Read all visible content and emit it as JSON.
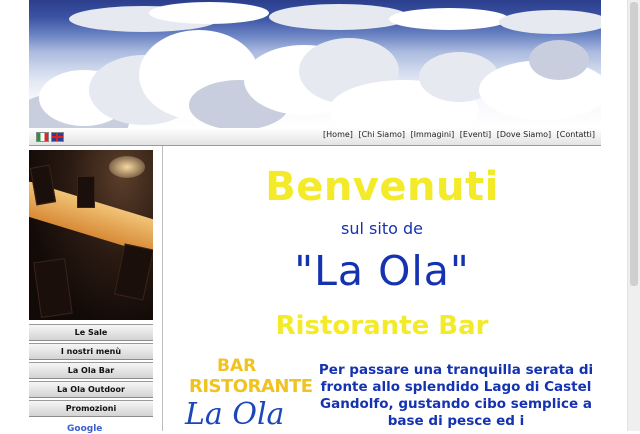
{
  "header": {
    "languages": [
      "it",
      "en"
    ],
    "nav": [
      "[Home]",
      "[Chi Siamo]",
      "[Immagini]",
      "[Eventi]",
      "[Dove Siamo]",
      "[Contatti]"
    ]
  },
  "sidebar": {
    "items": [
      "Le Sale",
      "I nostri menù",
      "La Ola Bar",
      "La Ola Outdoor",
      "Promozioni"
    ],
    "google_label": "Google"
  },
  "main": {
    "welcome": "Benvenuti",
    "subtitle": "sul sito de",
    "name": "\"La Ola\"",
    "tagline": "Ristorante Bar",
    "logo": {
      "bar": "BAR",
      "ristorante": "RISTORANTE",
      "laola": "La Ola"
    },
    "description": "Per passare una tranquilla serata di fronte allo splendido Lago di Castel Gandolfo, gustando cibo semplice a base di pesce ed i"
  },
  "colors": {
    "yellow": "#f3ea2a",
    "blue": "#1533b0"
  }
}
